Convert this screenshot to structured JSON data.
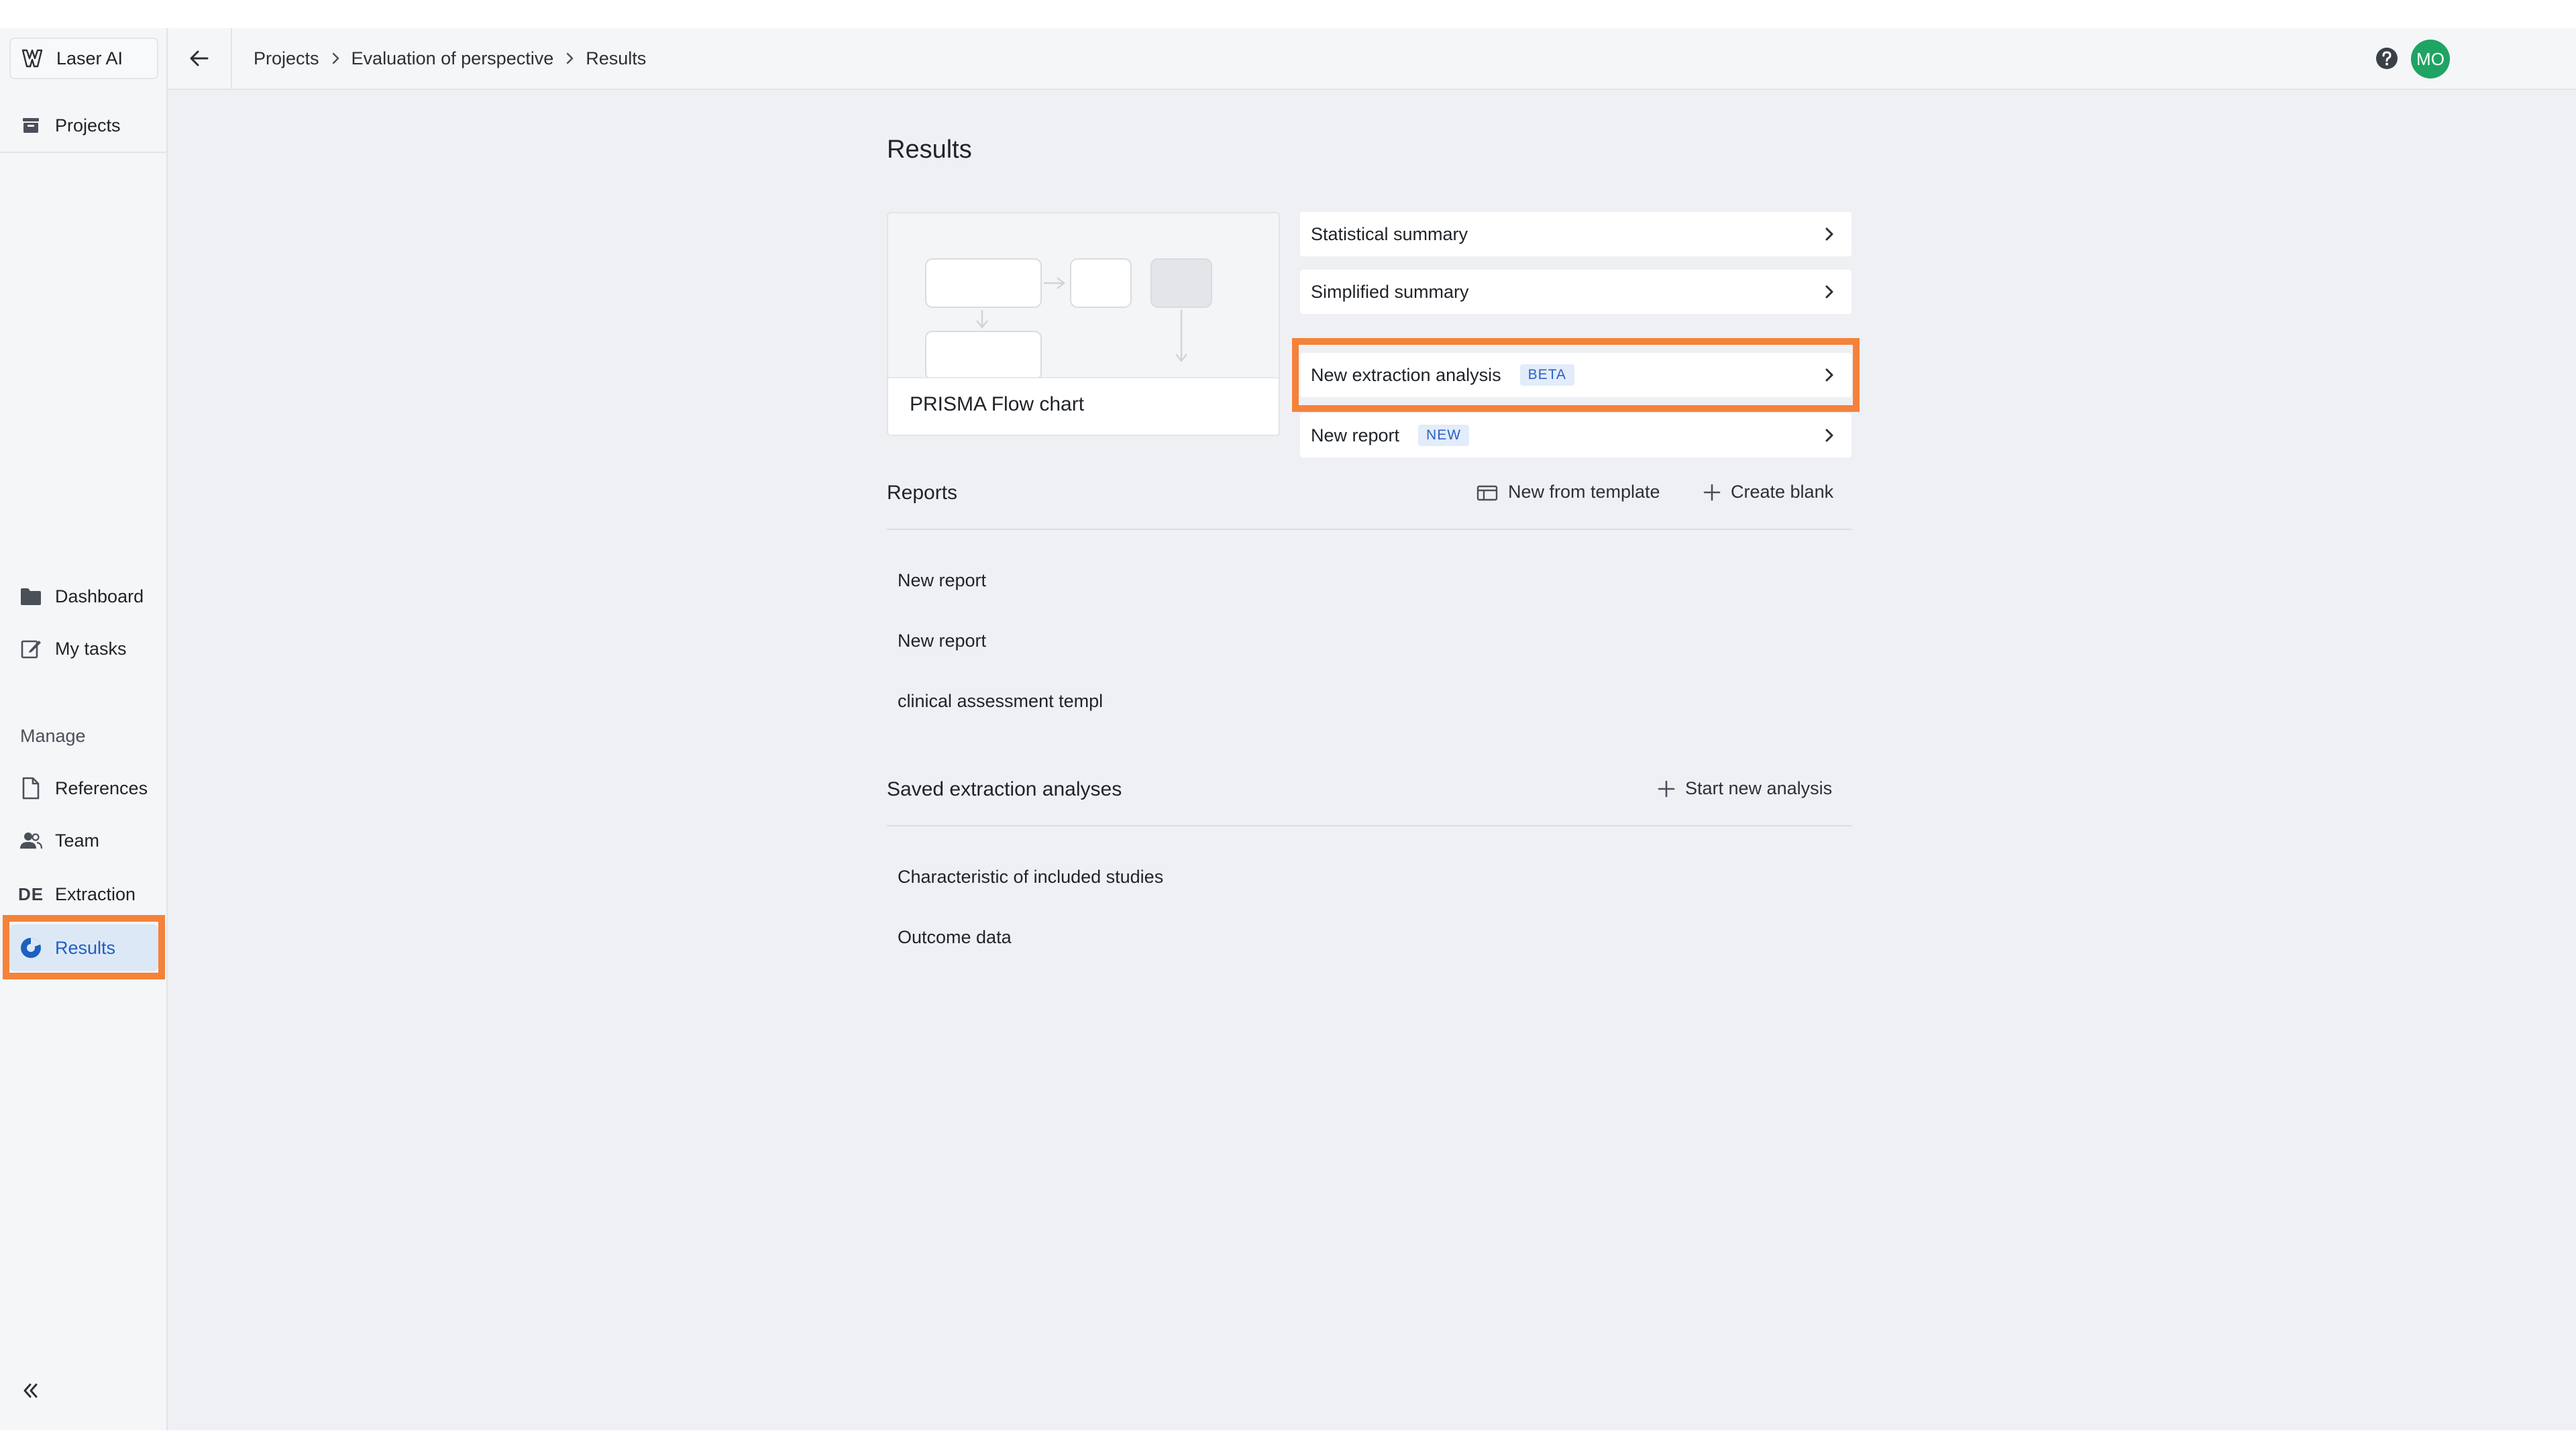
{
  "app": {
    "name": "Laser AI",
    "colors": {
      "accent": "#1f5fbf",
      "highlight": "#f5823a",
      "avatar": "#1fa463",
      "badge_bg": "#e3ecfa",
      "badge_text": "#2a62c4"
    }
  },
  "sidebar": {
    "projects_label": "Projects",
    "items": [
      {
        "label": "Dashboard",
        "icon": "folder-icon"
      },
      {
        "label": "My tasks",
        "icon": "edit-icon"
      }
    ],
    "manage_label": "Manage",
    "manage_items": [
      {
        "label": "References",
        "icon": "document-icon"
      },
      {
        "label": "Team",
        "icon": "users-icon"
      },
      {
        "label": "Extraction",
        "icon": "de-icon",
        "icon_text": "DE"
      },
      {
        "label": "Results",
        "icon": "results-icon",
        "active": true
      }
    ]
  },
  "header": {
    "breadcrumb": [
      "Projects",
      "Evaluation of perspective",
      "Results"
    ],
    "avatar_initials": "MO"
  },
  "main": {
    "title": "Results",
    "prisma_label": "PRISMA Flow chart",
    "cards": [
      {
        "label": "Statistical summary"
      },
      {
        "label": "Simplified summary"
      },
      {
        "label": "New extraction analysis",
        "badge": "BETA"
      },
      {
        "label": "New report",
        "badge": "NEW"
      }
    ],
    "reports": {
      "title": "Reports",
      "new_from_template": "New from template",
      "create_blank": "Create blank",
      "items": [
        "New report",
        "New report",
        "clinical assessment templ"
      ]
    },
    "analyses": {
      "title": "Saved extraction analyses",
      "start_new": "Start new analysis",
      "items": [
        "Characteristic of included studies",
        "Outcome data"
      ]
    }
  }
}
